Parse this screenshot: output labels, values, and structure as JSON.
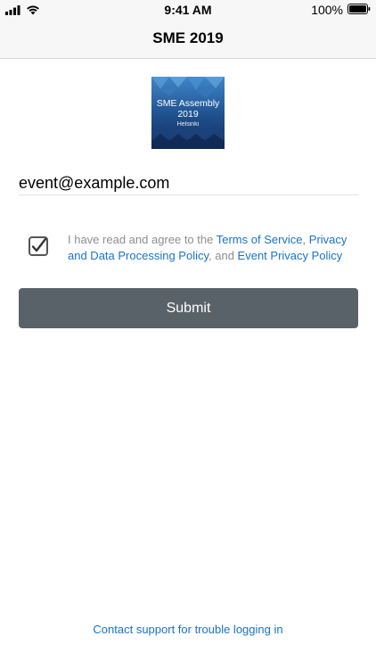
{
  "status_bar": {
    "time": "9:41 AM",
    "battery": "100%",
    "icons": [
      "signal-icon",
      "wifi-icon",
      "battery-icon"
    ]
  },
  "nav": {
    "title": "SME 2019"
  },
  "logo": {
    "line1": "SME Assembly",
    "line2": "2019",
    "line3": "Helsinki"
  },
  "form": {
    "email_value": "event@example.com",
    "consent_checked": true,
    "consent": {
      "prefix": "I have read and agree to the ",
      "terms_link": "Terms of Service",
      "sep1": ", ",
      "privacy_link": "Privacy and Data Processing Policy",
      "sep2": ", and ",
      "event_privacy_link": "Event Privacy Policy"
    },
    "submit_label": "Submit"
  },
  "support": {
    "label": "Contact support for trouble logging in"
  },
  "colors": {
    "link": "#1a73c8",
    "button": "#5a6269",
    "logo_dark": "#163a6b",
    "logo_light": "#3f86c9"
  }
}
